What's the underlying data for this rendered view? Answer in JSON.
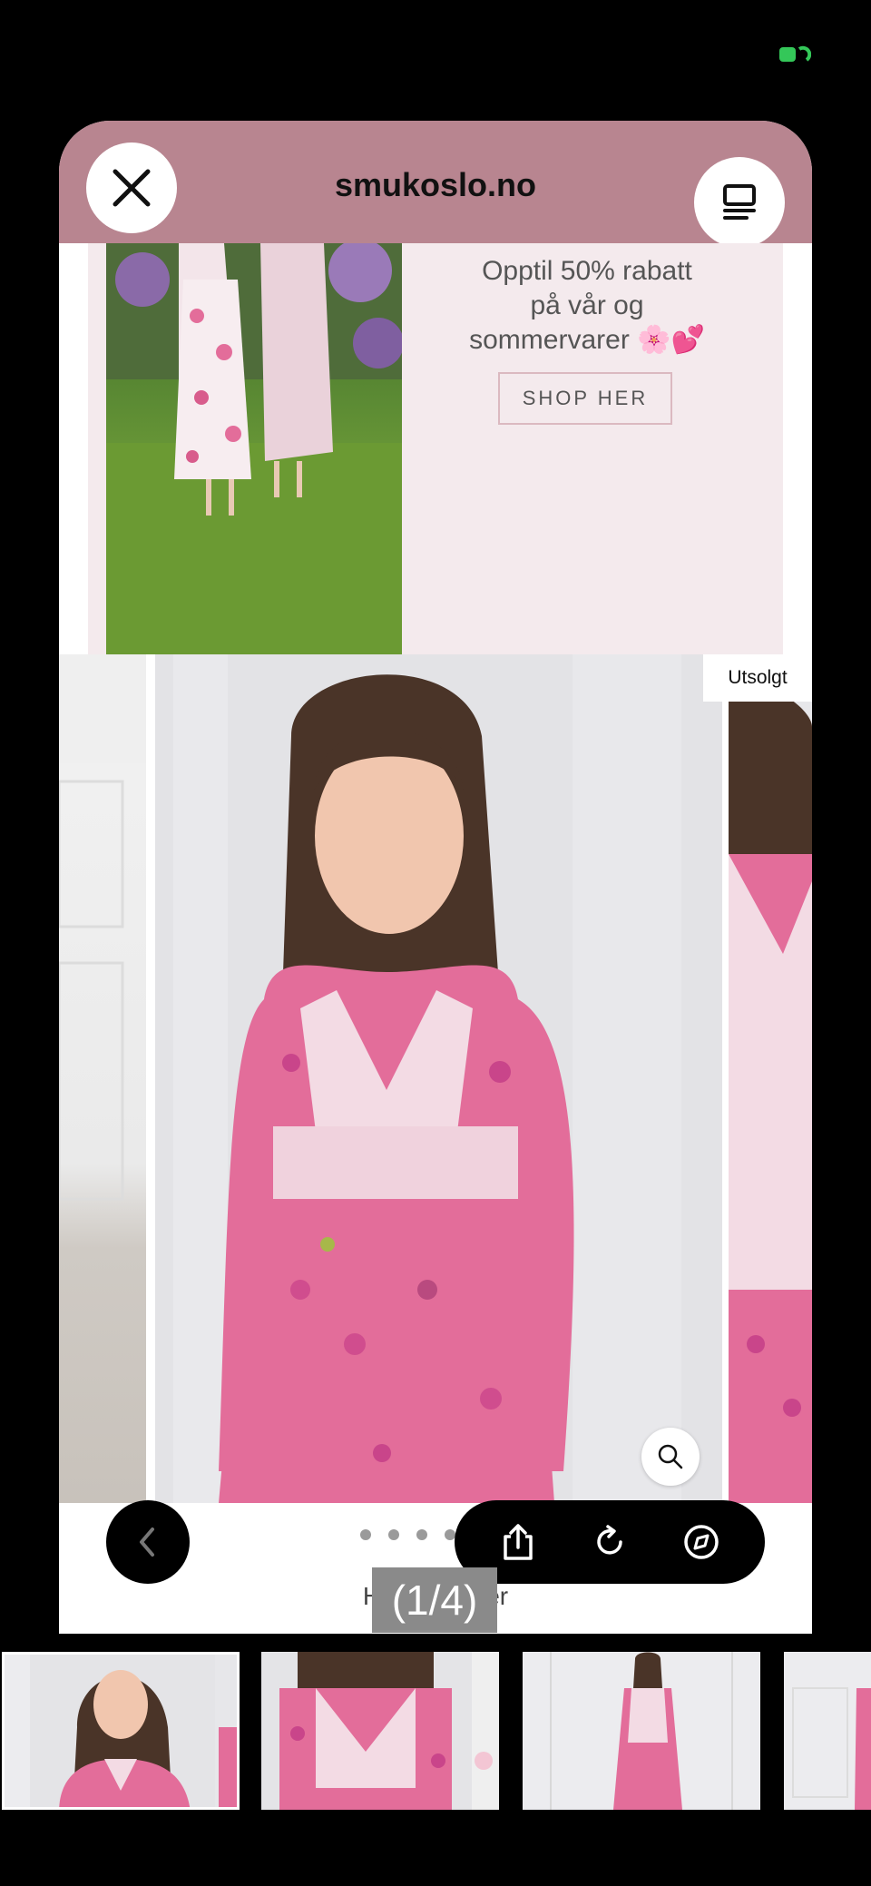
{
  "status_bar": {
    "battery_icon": "battery-charging-icon",
    "battery_color": "#34c759"
  },
  "browser": {
    "site_title": "smukoslo.no",
    "header_color": "#b88590",
    "close_icon": "close-icon",
    "reader_icon": "reader-mode-icon"
  },
  "promo": {
    "line1": "Opptil 50% rabatt",
    "line2": "på vår og",
    "line3": "sommervarer 🌸💕",
    "button_label": "SHOP HER"
  },
  "product": {
    "badge": "Utsolgt",
    "zoom_icon": "magnifier-icon",
    "dot_count": 6,
    "breadcrumb": "Hjem / Kjoler"
  },
  "toolbar": {
    "back_icon": "chevron-left-icon",
    "share_icon": "share-icon",
    "reload_icon": "reload-icon",
    "compass_icon": "compass-icon"
  },
  "viewer": {
    "counter": "(1/4)"
  }
}
